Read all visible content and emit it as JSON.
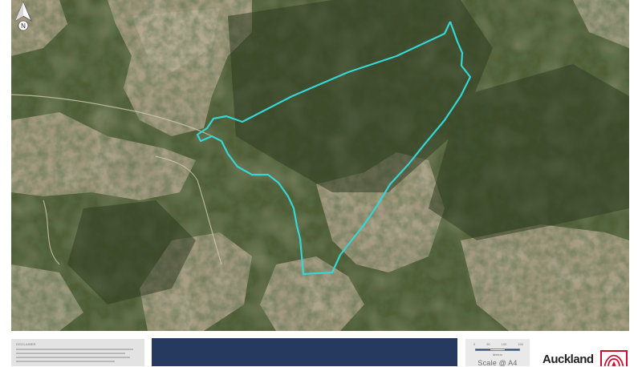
{
  "map": {
    "boundary_color": "#35d6d6",
    "north_arrow": {
      "icon": "north-arrow-icon",
      "label": "N"
    }
  },
  "footer": {
    "disclaimer_title": "DISCLAIMER",
    "title_block_color": "#253a5e",
    "scale": {
      "ticks": [
        "0",
        "50",
        "100",
        "150"
      ],
      "units": "Meters",
      "label": "Scale @ A4"
    },
    "logo": {
      "text": "Auckland",
      "icon": "auckland-council-logo-icon",
      "color": "#c8102e"
    }
  }
}
